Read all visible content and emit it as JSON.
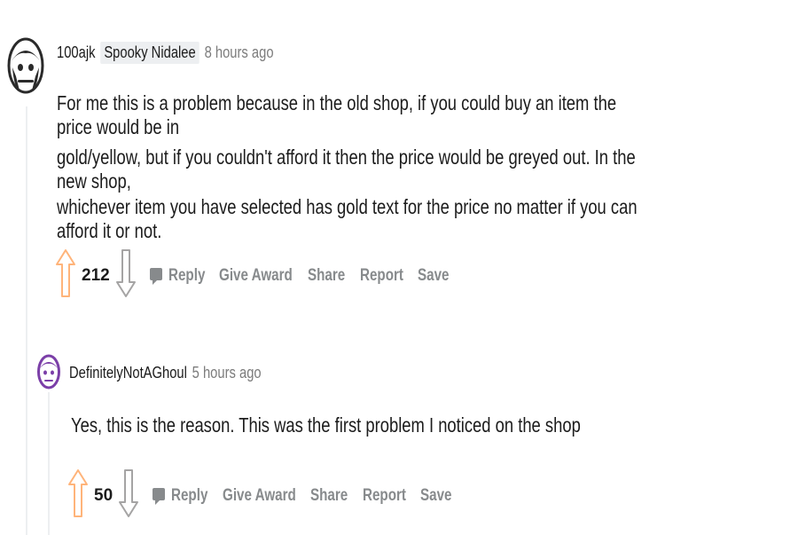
{
  "comment": {
    "author": "100ajk",
    "flair": "Spooky Nidalee",
    "time": "8 hours ago",
    "lines": [
      "For me this is a problem because in the old shop, if you could buy an item the price would be in",
      "gold/yellow, but if you couldn't afford it then the price would be greyed out. In the new shop,",
      "whichever item you have selected has gold text for the price no matter if you can afford it or not."
    ],
    "score": "212",
    "actions": {
      "reply": "Reply",
      "award": "Give Award",
      "share": "Share",
      "report": "Report",
      "save": "Save"
    }
  },
  "reply": {
    "author": "DefinitelyNotAGhoul",
    "time": "5 hours ago",
    "text": "Yes, this is the reason. This was the first problem I noticed on the shop",
    "score": "50",
    "actions": {
      "reply": "Reply",
      "award": "Give Award",
      "share": "Share",
      "report": "Report",
      "save": "Save"
    }
  },
  "colors": {
    "meta": "#7c7c7c",
    "action": "#878a8c",
    "thread": "#edeff1",
    "text": "#1c1c1c"
  },
  "icons": [
    "upvote-icon",
    "downvote-icon",
    "comment-bubble-icon",
    "avatar-icon"
  ]
}
